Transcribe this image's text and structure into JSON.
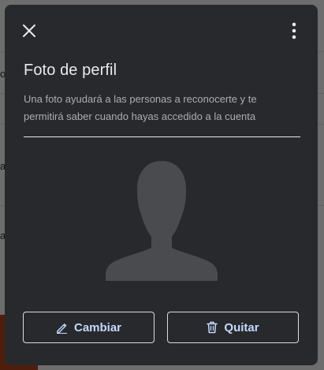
{
  "dialog": {
    "title": "Foto de perfil",
    "description": "Una foto ayudará a las personas a reconocerte y te permitirá saber cuando hayas accedido a la cuenta",
    "close_icon": "close-icon",
    "more_icon": "more-vert-icon",
    "avatar_icon": "person-silhouette-icon",
    "buttons": {
      "change_label": "Cambiar",
      "change_icon": "pencil-icon",
      "remove_label": "Quitar",
      "remove_icon": "trash-icon"
    }
  },
  "background": {
    "letters": [
      "o",
      "a",
      "a"
    ]
  },
  "colors": {
    "dialog_bg": "#28292c",
    "accent_text": "#c4d8ff",
    "avatar_fill": "#4a4b4e",
    "scrim": "rgba(0,0,0,0.55)"
  }
}
